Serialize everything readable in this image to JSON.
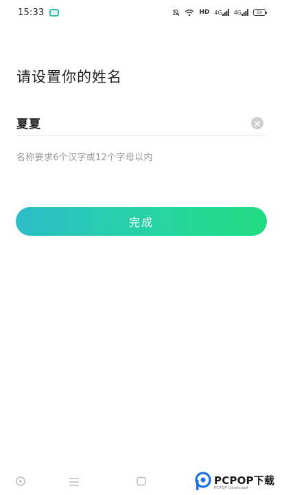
{
  "status_bar": {
    "time": "15:33",
    "network_type": "HD",
    "signal_1": "4G",
    "signal_2": "4G",
    "battery": "59"
  },
  "page": {
    "title": "请设置你的姓名"
  },
  "name_field": {
    "value": "夏夏",
    "placeholder": ""
  },
  "hint": "名称要求6个汉字或12个字母以内",
  "done_button": {
    "label": "完成"
  },
  "watermark": {
    "brand": "PCPOP下载",
    "sub": "PCPOP Download"
  },
  "colors": {
    "accent_start": "#2dbdc8",
    "accent_end": "#22dc82",
    "hint_text": "#9a9a9a"
  }
}
